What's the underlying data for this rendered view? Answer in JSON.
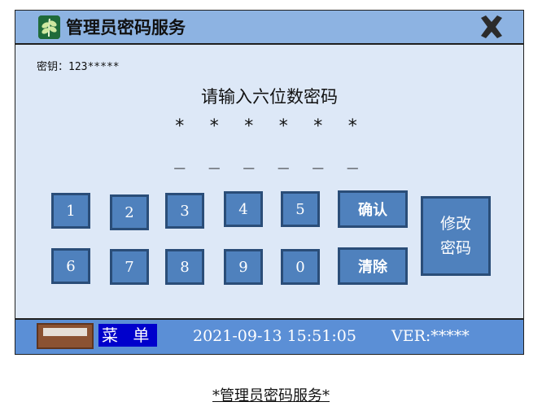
{
  "window": {
    "title": "管理员密码服务",
    "app_icon": "leaf-app-icon",
    "close_icon": "close-x-icon"
  },
  "main": {
    "key_info": "密钥：123*****",
    "prompt": "请输入六位数密码",
    "masked_input": "* * * * * *",
    "input_slots": "_ _ _ _ _ _"
  },
  "keypad": {
    "row1": [
      "1",
      "2",
      "3",
      "4",
      "5"
    ],
    "row2": [
      "6",
      "7",
      "8",
      "9",
      "0"
    ],
    "confirm_label": "确认",
    "clear_label": "清除",
    "change_password_line1": "修改",
    "change_password_line2": "密码"
  },
  "statusbar": {
    "menu_label": "菜 单",
    "datetime": "2021-09-13 15:51:05",
    "version": "VER:*****"
  },
  "caption": "*管理员密码服务*",
  "colors": {
    "titlebar": "#8db3e2",
    "panel": "#dde8f7",
    "button": "#4f81bd",
    "button_border": "#2a4d78",
    "statusbar": "#5b8fd6",
    "menu_highlight": "#0000cc"
  }
}
